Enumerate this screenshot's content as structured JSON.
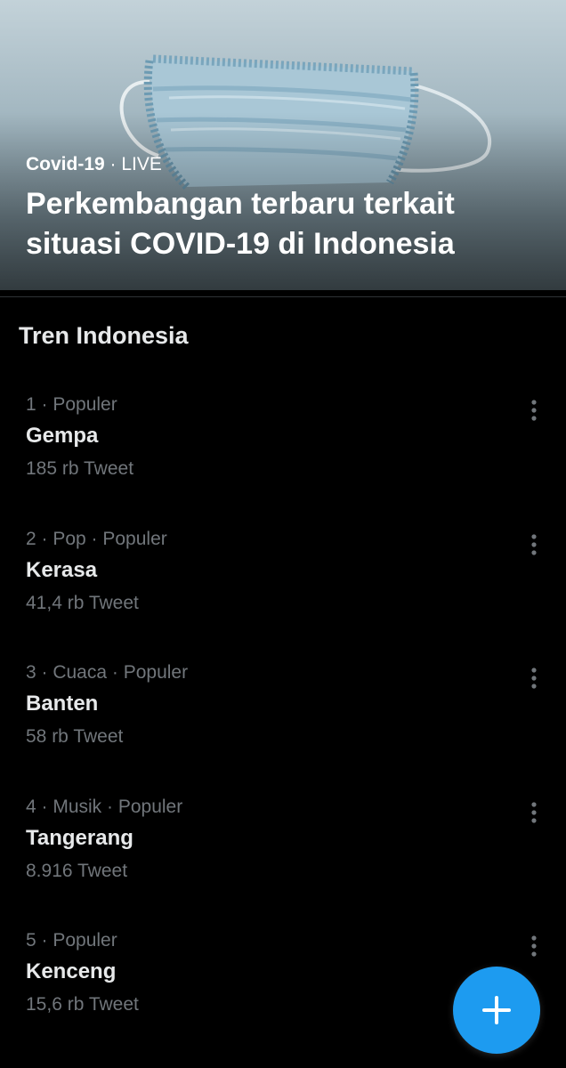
{
  "hero": {
    "topic": "Covid-19",
    "separator": " · ",
    "live_label": "LIVE",
    "title": "Perkembangan terbaru terkait situasi COVID-19 di Indonesia",
    "image_icon": "surgical-mask-image"
  },
  "trends_section": {
    "title": "Tren Indonesia",
    "items": [
      {
        "meta": "1 · Populer",
        "name": "Gempa",
        "count": "185 rb Tweet"
      },
      {
        "meta": "2 · Pop · Populer",
        "name": "Kerasa",
        "count": "41,4 rb Tweet"
      },
      {
        "meta": "3 · Cuaca · Populer",
        "name": "Banten",
        "count": "58 rb Tweet"
      },
      {
        "meta": "4 · Musik · Populer",
        "name": "Tangerang",
        "count": "8.916 Tweet"
      },
      {
        "meta": "5 · Populer",
        "name": "Kenceng",
        "count": "15,6 rb Tweet"
      }
    ]
  },
  "fab": {
    "icon": "plus-icon"
  },
  "colors": {
    "background": "#000000",
    "primary_text": "#e7e9ea",
    "secondary_text": "#71767b",
    "accent": "#1d9bf0"
  }
}
